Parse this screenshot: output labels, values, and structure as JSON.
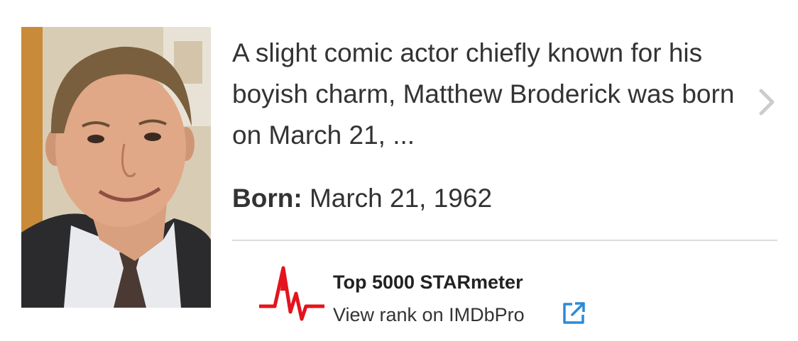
{
  "person": {
    "bio": "A slight comic actor chiefly known for his boyish charm, Matthew Broderick was born on March 21, ...",
    "born_label": "Born:",
    "born_value": "March 21, 1962",
    "photo_icon": "actor-headshot"
  },
  "navigation": {
    "next_icon": "chevron-right-icon"
  },
  "starmeter": {
    "title": "Top 5000 STARmeter",
    "link_text": "View rank on IMDbPro",
    "icon": "starmeter-pulse-icon",
    "link_icon": "external-link-icon"
  },
  "colors": {
    "starmeter_red": "#e3141e",
    "link_blue": "#2b8ad9",
    "chevron_gray": "#cccccc",
    "divider": "#dddddd"
  }
}
